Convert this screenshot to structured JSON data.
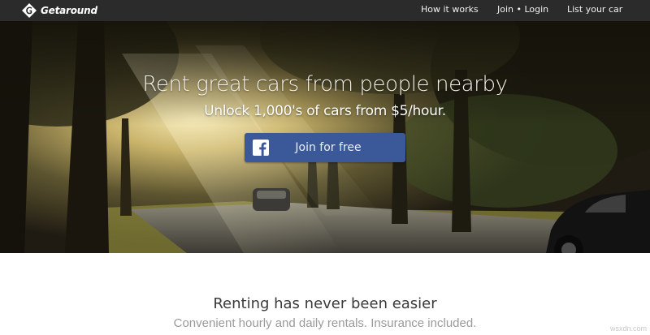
{
  "header": {
    "brand": "Getaround",
    "nav": {
      "how_it_works": "How it works",
      "join_login": "Join • Login",
      "list_your_car": "List your car"
    }
  },
  "hero": {
    "headline": "Rent great cars from people nearby",
    "subheadline": "Unlock 1,000's of cars from $5/hour.",
    "join_button": {
      "label": "Join for free",
      "icon": "facebook-icon",
      "color": "#3b5998"
    }
  },
  "section": {
    "title": "Renting has never been easier",
    "subtitle": "Convenient hourly and daily rentals. Insurance included."
  },
  "watermark": "wsxdn.com",
  "colors": {
    "topbar": "#2b2b2b",
    "accent_facebook": "#3b5998"
  }
}
